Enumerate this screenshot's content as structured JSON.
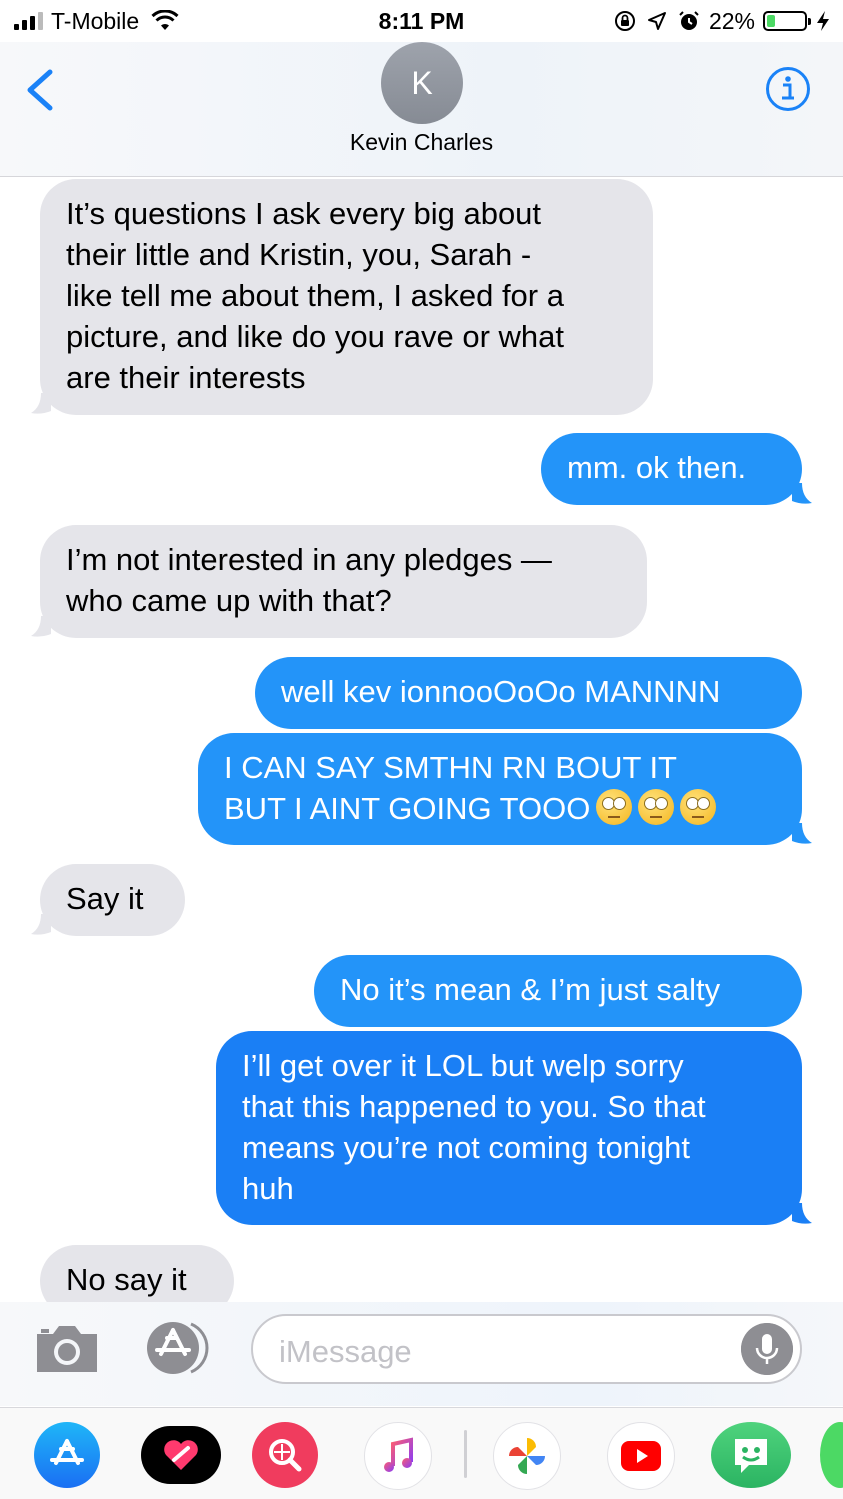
{
  "status_bar": {
    "carrier": "T-Mobile",
    "time": "8:11 PM",
    "battery_percent": "22%",
    "battery_level": 0.22,
    "icons": [
      "signal-icon",
      "wifi-icon",
      "rotation-lock-icon",
      "location-arrow-icon",
      "alarm-icon",
      "battery-icon",
      "charging-bolt-icon"
    ]
  },
  "header": {
    "avatar_initial": "K",
    "contact_name": "Kevin Charles",
    "back_icon": "chevron-left-icon",
    "info_icon": "info-icon"
  },
  "messages": [
    {
      "direction": "incoming",
      "lines": [
        "It’s questions I ask every big about",
        "their little and Kristin, you, Sarah -",
        "like tell me about them, I asked for a",
        "picture, and like do you rave or what",
        "are their interests"
      ]
    },
    {
      "direction": "outgoing",
      "lines": [
        "mm. ok then."
      ]
    },
    {
      "direction": "incoming",
      "lines": [
        "I’m not interested in any pledges —",
        "who came up with that?"
      ]
    },
    {
      "direction": "outgoing",
      "lines": [
        "well kev ionnooOoOo MANNNN"
      ]
    },
    {
      "direction": "outgoing",
      "lines": [
        "I CAN SAY SMTHN RN BOUT IT",
        "BUT I AINT GOING TOOO"
      ],
      "emoji": "face-with-rolling-eyes",
      "emoji_count": 3
    },
    {
      "direction": "incoming",
      "lines": [
        "Say it"
      ]
    },
    {
      "direction": "outgoing",
      "lines": [
        "No it’s mean & I’m just salty"
      ]
    },
    {
      "direction": "outgoing",
      "lines": [
        "I’ll get over it LOL but welp sorry",
        "that this happened to you. So that",
        "means you’re not coming tonight",
        "huh"
      ]
    },
    {
      "direction": "incoming",
      "lines": [
        "No say it"
      ]
    }
  ],
  "input_bar": {
    "placeholder": "iMessage",
    "camera_icon": "camera-icon",
    "apps_icon": "app-store-icon",
    "mic_icon": "microphone-icon"
  },
  "app_drawer": [
    "app-store-app-icon",
    "digital-touch-app-icon",
    "search-images-app-icon",
    "music-app-icon",
    "photos-app-icon",
    "youtube-app-icon",
    "bitmoji-app-icon",
    "more-apps-icon"
  ],
  "colors": {
    "incoming_bubble": "#e5e5ea",
    "outgoing_bubble": "#2394f9",
    "accent": "#1a82f7"
  }
}
